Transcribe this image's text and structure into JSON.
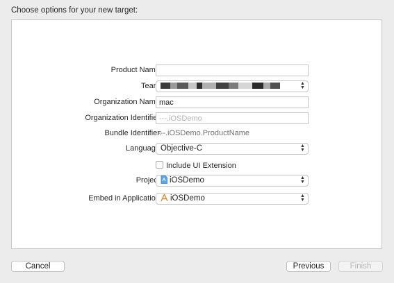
{
  "heading": "Choose options for your new target:",
  "form": {
    "product_name": {
      "label": "Product Name:",
      "value": ""
    },
    "team": {
      "label": "Team:"
    },
    "organization_name": {
      "label": "Organization Name:",
      "value": "mac"
    },
    "organization_identifier": {
      "label": "Organization Identifier:",
      "placeholder": "---.iOSDemo"
    },
    "bundle_identifier": {
      "label": "Bundle Identifier:",
      "value": "---.iOSDemo.ProductName"
    },
    "language": {
      "label": "Language:",
      "value": "Objective-C"
    },
    "include_ui_extension": {
      "label": "Include UI Extension",
      "checked": false
    },
    "project": {
      "label": "Project:",
      "value": "iOSDemo",
      "icon": "xcode-project-icon"
    },
    "embed_in_application": {
      "label": "Embed in Application:",
      "value": "iOSDemo",
      "icon": "app-icon"
    }
  },
  "buttons": {
    "cancel": "Cancel",
    "previous": "Previous",
    "finish": "Finish"
  }
}
